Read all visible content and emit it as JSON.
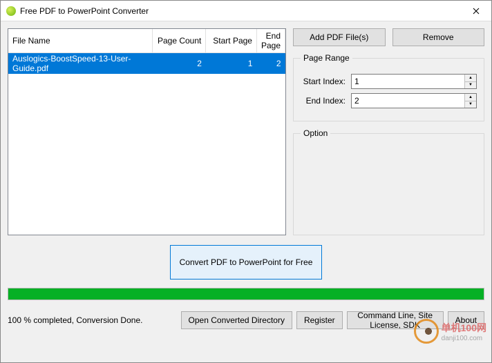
{
  "window": {
    "title": "Free PDF to PowerPoint Converter"
  },
  "table": {
    "headers": {
      "file": "File Name",
      "pages": "Page Count",
      "start": "Start Page",
      "end": "End Page"
    },
    "rows": [
      {
        "file": "Auslogics-BoostSpeed-13-User-Guide.pdf",
        "pages": "2",
        "start": "1",
        "end": "2"
      }
    ]
  },
  "side": {
    "add": "Add PDF File(s)",
    "remove": "Remove",
    "pageRange": {
      "legend": "Page Range",
      "startLabel": "Start Index:",
      "startValue": "1",
      "endLabel": "End Index:",
      "endValue": "2"
    },
    "option": {
      "legend": "Option"
    }
  },
  "convert": "Convert PDF to PowerPoint for Free",
  "status": "100 % completed, Conversion Done.",
  "footer": {
    "openDir": "Open Converted Directory",
    "register": "Register",
    "cmdLine": "Command Line, Site License, SDK",
    "about": "About"
  },
  "watermark": {
    "brand": "单机100网",
    "url": "danji100.com"
  }
}
